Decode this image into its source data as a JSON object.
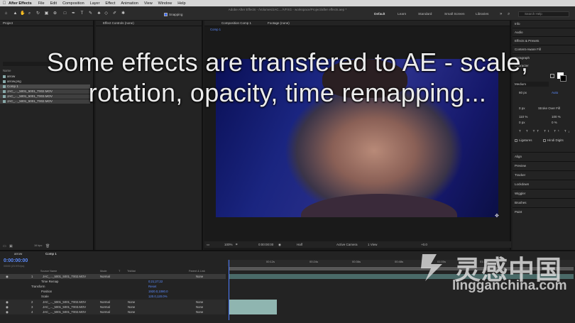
{
  "menubar": {
    "apple": "",
    "app_name": "After Effects",
    "items": [
      "File",
      "Edit",
      "Composition",
      "Layer",
      "Effect",
      "Animation",
      "View",
      "Window",
      "Help"
    ]
  },
  "window_title": "Adobe After Effects - /Volumes/JAC..../VFXG - workspace/Project/after effects.aep *",
  "toolbar": {
    "snapping_label": "Snapping",
    "workspaces": [
      "Default",
      "Learn",
      "Standard",
      "Small Screen",
      "Libraries"
    ],
    "search_placeholder": "Search Help"
  },
  "project_panel": {
    "title": "Project",
    "column_header": "Name",
    "items": [
      "arrow",
      "arrow.png",
      "Comp 1",
      "JAC_..._5001_5001_T002.MOV",
      "JAC_..._5001_5001_T003.MOV",
      "JAC_..._5001_5001_T002.MOV"
    ],
    "footer_label": "16 bpc"
  },
  "effect_controls": {
    "title": "Effect Controls (none)"
  },
  "composition_panel": {
    "tab": "Composition Comp 1",
    "footage_tab": "Footage (none)",
    "sub_tab": "Comp 1",
    "zoom": "100%",
    "timecode": "0:00:00:00",
    "resolution": "Half",
    "camera": "Active Camera",
    "views": "1 View",
    "exposure": "+0.0"
  },
  "right_panel": {
    "items_top": [
      "Info",
      "Audio",
      "Effects & Presets",
      "Content-Aware Fill",
      "Paragraph",
      "Character"
    ],
    "font_weight": "Medium",
    "font_size": "60 px",
    "tracking": "Auto",
    "leading": "0 px",
    "stroke": "Stroke Over Fill",
    "scale_v": "110 %",
    "scale_h": "100 %",
    "baseline": "0 px",
    "tsume": "0 %",
    "ligatures_label": "Ligatures",
    "hindi_label": "Hindi Digits",
    "items_bottom": [
      "Align",
      "Preview",
      "Tracker",
      "Lockdown",
      "Wiggler",
      "Brushes",
      "Paint"
    ]
  },
  "timeline": {
    "tabs": [
      "arrow",
      "Comp 1"
    ],
    "current_time": "0:00:00:00",
    "fps_note": "00000 (23.976 fps)",
    "columns": [
      "Source Name",
      "Mode",
      "T",
      "TrkMat",
      "Parent & Link"
    ],
    "rows": [
      {
        "num": "1",
        "name": "JAC_..._5001_5001_T002.MOV",
        "mode": "Normal",
        "parent": "None"
      },
      {
        "num": "",
        "name": "Time Remap",
        "value": "0;21;27;22"
      },
      {
        "num": "",
        "name": "Transform",
        "value": "Reset"
      },
      {
        "num": "",
        "name": "Position",
        "value": "1920.0,1080.0"
      },
      {
        "num": "",
        "name": "Scale",
        "value": "120.0,120.0%"
      },
      {
        "num": "2",
        "name": "JAC_..._5001_5001_T002.MOV",
        "mode": "Normal",
        "trkmat": "None",
        "parent": "None"
      },
      {
        "num": "3",
        "name": "JAC_..._5001_5001_T003.MOV",
        "mode": "Normal",
        "trkmat": "None",
        "parent": "None"
      },
      {
        "num": "4",
        "name": "JAC_..._5001_5001_T002.MOV",
        "mode": "Normal",
        "trkmat": "None",
        "parent": "None"
      }
    ],
    "ruler_labels": [
      "00:12s",
      "00:24s",
      "00:36s",
      "00:48s",
      "01:00s",
      "01:12s"
    ]
  },
  "caption": {
    "line1": "Some effects are transfered to AE - scale,",
    "line2": "rotation, opacity, time remapping..."
  },
  "watermark": {
    "chinese": "灵感中国",
    "domain": "lingganchina.com"
  },
  "colors": {
    "accent_blue": "#4d7cff",
    "panel_bg": "#232323",
    "layer_bar": "#8fb5b0"
  }
}
